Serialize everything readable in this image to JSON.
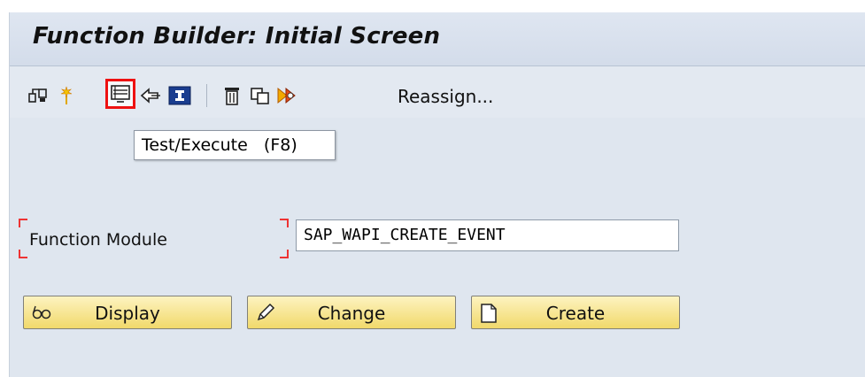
{
  "window": {
    "title": "Function Builder: Initial Screen"
  },
  "toolbar": {
    "icons": [
      "other-object-icon",
      "check-icon",
      "test-execute-icon",
      "where-used-icon",
      "info-icon",
      "delete-icon",
      "copy-icon",
      "rename-icon"
    ],
    "reassign_label": "Reassign..."
  },
  "tooltip": {
    "text": "Test/Execute   (F8)"
  },
  "form": {
    "function_module_label": "Function Module",
    "function_module_value": "SAP_WAPI_CREATE_EVENT"
  },
  "buttons": {
    "display_label": "Display",
    "change_label": "Change",
    "create_label": "Create"
  },
  "colors": {
    "accent_highlight": "#ee1111",
    "button_fill": "#f4dd7a",
    "background": "#dfe6ef"
  }
}
